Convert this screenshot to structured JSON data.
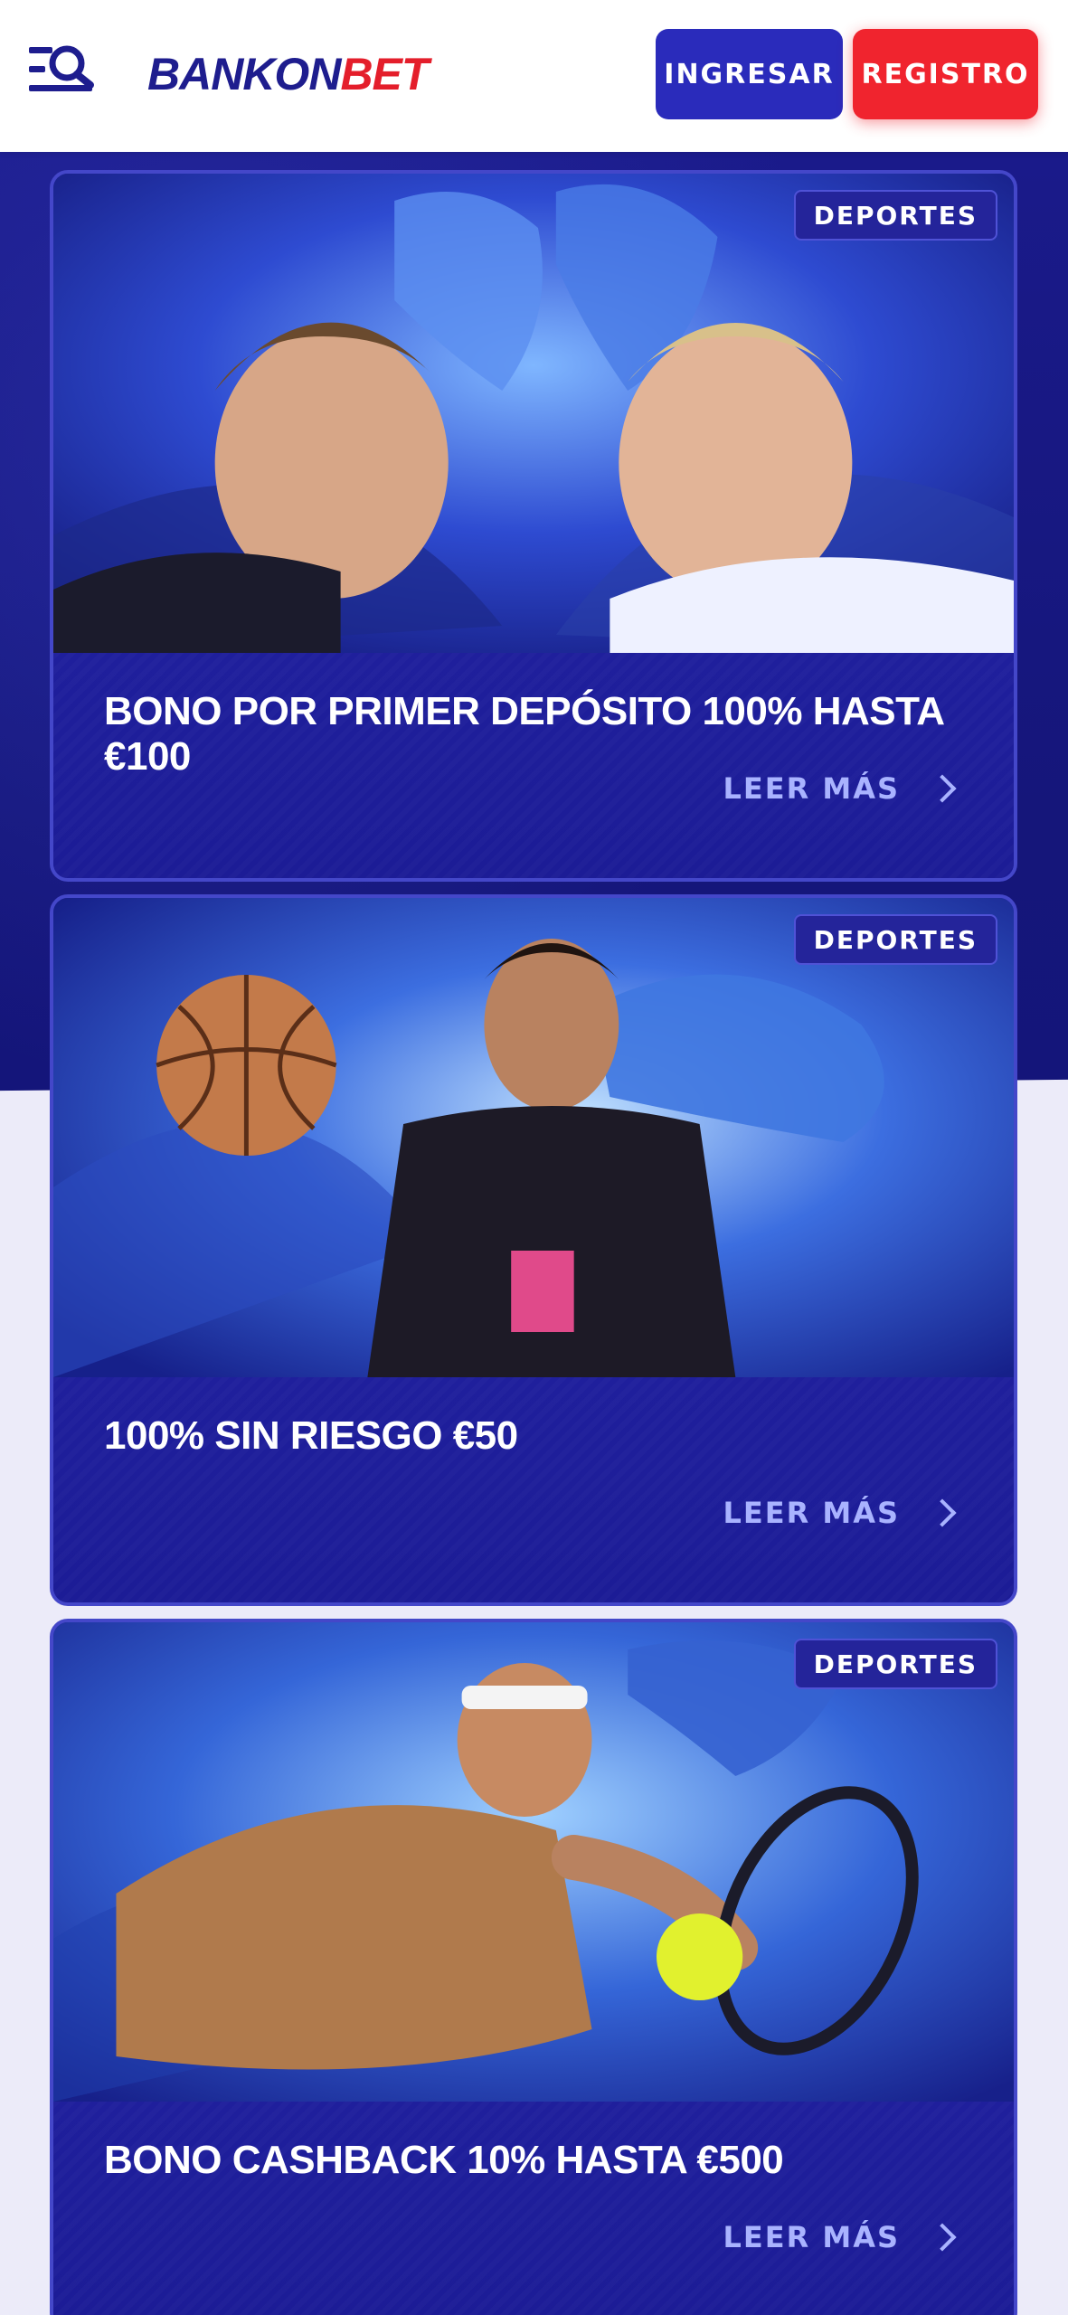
{
  "header": {
    "logo_part1": "BANKON",
    "logo_part2": "BET",
    "login_label": "INGRESAR",
    "register_label": "REGISTRO",
    "menu_icon": "menu-search-icon"
  },
  "colors": {
    "brand_dark": "#1e1d8e",
    "brand_red": "#e41e2b",
    "login_button": "#2a2bbb",
    "register_button": "#f0242e",
    "card_background": "#1e1f9a",
    "read_more_text": "#a9b3ff"
  },
  "promos": [
    {
      "tag": "DEPORTES",
      "title": "BONO POR PRIMER DEPÓSITO 100% HASTA €100",
      "read_more": "LEER MÁS",
      "image_icon": "football-players-lions-image"
    },
    {
      "tag": "DEPORTES",
      "title": "100% SIN RIESGO €50",
      "read_more": "LEER MÁS",
      "image_icon": "basketball-player-dolphin-image"
    },
    {
      "tag": "DEPORTES",
      "title": "BONO CASHBACK 10% HASTA €500",
      "read_more": "LEER MÁS",
      "image_icon": "tennis-player-eagle-image"
    }
  ]
}
